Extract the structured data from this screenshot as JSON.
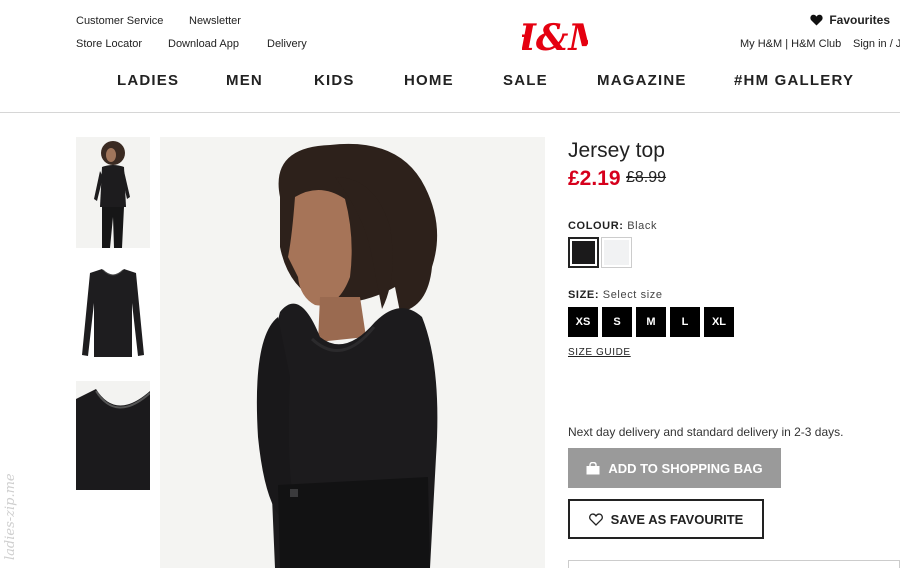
{
  "header": {
    "links_left_row1": [
      "Customer Service",
      "Newsletter"
    ],
    "links_left_row2": [
      "Store Locator",
      "Download App",
      "Delivery"
    ],
    "logo_text": "H&M",
    "favourites_label": "Favourites",
    "account_links": "My H&M | H&M Club",
    "sign_in": "Sign in / J",
    "nav": [
      "LADIES",
      "MEN",
      "KIDS",
      "HOME",
      "SALE",
      "MAGAZINE",
      "#HM GALLERY"
    ]
  },
  "product": {
    "title": "Jersey top",
    "price_now": "£2.19",
    "price_old": "£8.99",
    "colour_label": "COLOUR:",
    "colour_value": "Black",
    "swatches": [
      {
        "name": "Black",
        "color": "#1b1a1b"
      },
      {
        "name": "White",
        "color": "#f1f2f3"
      }
    ],
    "size_label": "SIZE:",
    "size_value": "Select size",
    "sizes": [
      "XS",
      "S",
      "M",
      "L",
      "XL"
    ],
    "size_guide": "SIZE GUIDE",
    "delivery_text": "Next day delivery and standard delivery in 2-3 days.",
    "add_to_bag": "ADD TO SHOPPING BAG",
    "save_favourite": "SAVE AS FAVOURITE"
  },
  "colors": {
    "sale_red": "#d6001c",
    "logo_red": "#e50010",
    "bag_button": "#9a9a9a"
  },
  "watermark": "ladies-zip.me"
}
